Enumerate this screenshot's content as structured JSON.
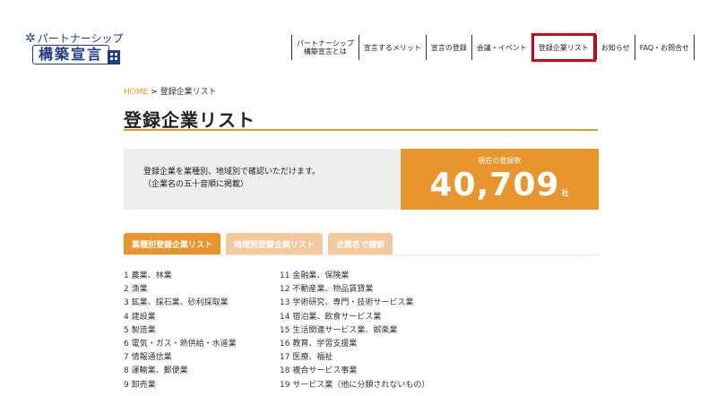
{
  "logo": {
    "line1": "パートナーシップ",
    "line2": "構築宣言"
  },
  "nav": [
    {
      "label": "パートナーシップ\n構築宣言とは"
    },
    {
      "label": "宣言するメリット"
    },
    {
      "label": "宣言の登録"
    },
    {
      "label": "会議・イベント"
    },
    {
      "label": "登録企業リスト"
    },
    {
      "label": "お知らせ"
    },
    {
      "label": "FAQ・お問合せ"
    }
  ],
  "breadcrumb": {
    "home": "HOME",
    "sep": " > ",
    "current": "登録企業リスト"
  },
  "page_title": "登録企業リスト",
  "info": {
    "line1": "登録企業を業種別、地域別で確認いただけます。",
    "line2": "（企業名の五十音順に掲載）"
  },
  "count": {
    "label": "現在の登録数",
    "value": "40,709",
    "unit": "社"
  },
  "tabs": [
    "業種別登録企業リスト",
    "地域別登録企業リスト",
    "企業名で検索"
  ],
  "categories_left": [
    "1 農業、林業",
    "2 漁業",
    "3 鉱業、採石業、砂利採取業",
    "4 建設業",
    "5 製造業",
    "6 電気・ガス・熱供給・水道業",
    "7 情報通信業",
    "8 運輸業、郵便業",
    "9 卸売業"
  ],
  "categories_right": [
    "11 金融業、保険業",
    "12 不動産業、物品賃貸業",
    "13 学術研究、専門・技術サービス業",
    "14 宿泊業、飲食サービス業",
    "15 生活関連サービス業、娯楽業",
    "16 教育、学習支援業",
    "17 医療、福祉",
    "18 複合サービス事業",
    "19 サービス業（他に分類されないもの）"
  ]
}
